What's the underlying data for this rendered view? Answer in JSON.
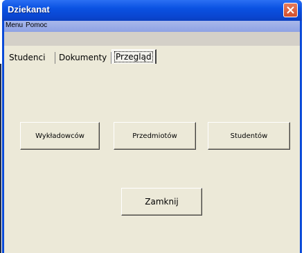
{
  "window": {
    "title": "Dziekanat"
  },
  "menu": {
    "items": [
      "Menu",
      "Pomoc"
    ]
  },
  "tabs": [
    "Studenci",
    "Dokumenty",
    "Przegląd"
  ],
  "buttons": {
    "lecturers": "Wykładowców",
    "subjects": "Przedmiotów",
    "students": "Studentów",
    "close": "Zamknij"
  }
}
